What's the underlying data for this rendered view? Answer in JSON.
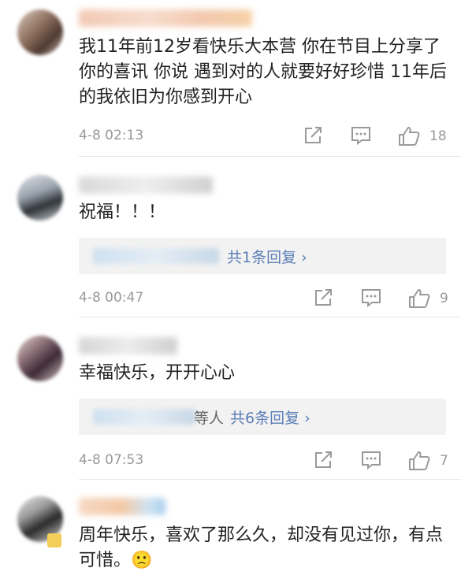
{
  "comments": [
    {
      "text": "我11年前12岁看快乐大本营 你在节目上分享了你的喜讯 你说 遇到对的人就要好好珍惜 11年后的我依旧为你感到开心",
      "time": "4-8 02:13",
      "likes": "18"
    },
    {
      "text": "祝福！！！",
      "reply": {
        "who": "",
        "summary": "共1条回复 ›"
      },
      "time": "4-8 00:47",
      "likes": "9"
    },
    {
      "text": "幸福快乐，开开心心",
      "reply": {
        "who": "等人",
        "summary": "共6条回复 ›"
      },
      "time": "4-8 07:53",
      "likes": "7"
    },
    {
      "text": "周年快乐，喜欢了那么久，却没有见过你，有点可惜。🙁"
    }
  ],
  "icons": {
    "share": "share-icon",
    "comment": "comment-icon",
    "like": "thumbs-up-icon"
  }
}
